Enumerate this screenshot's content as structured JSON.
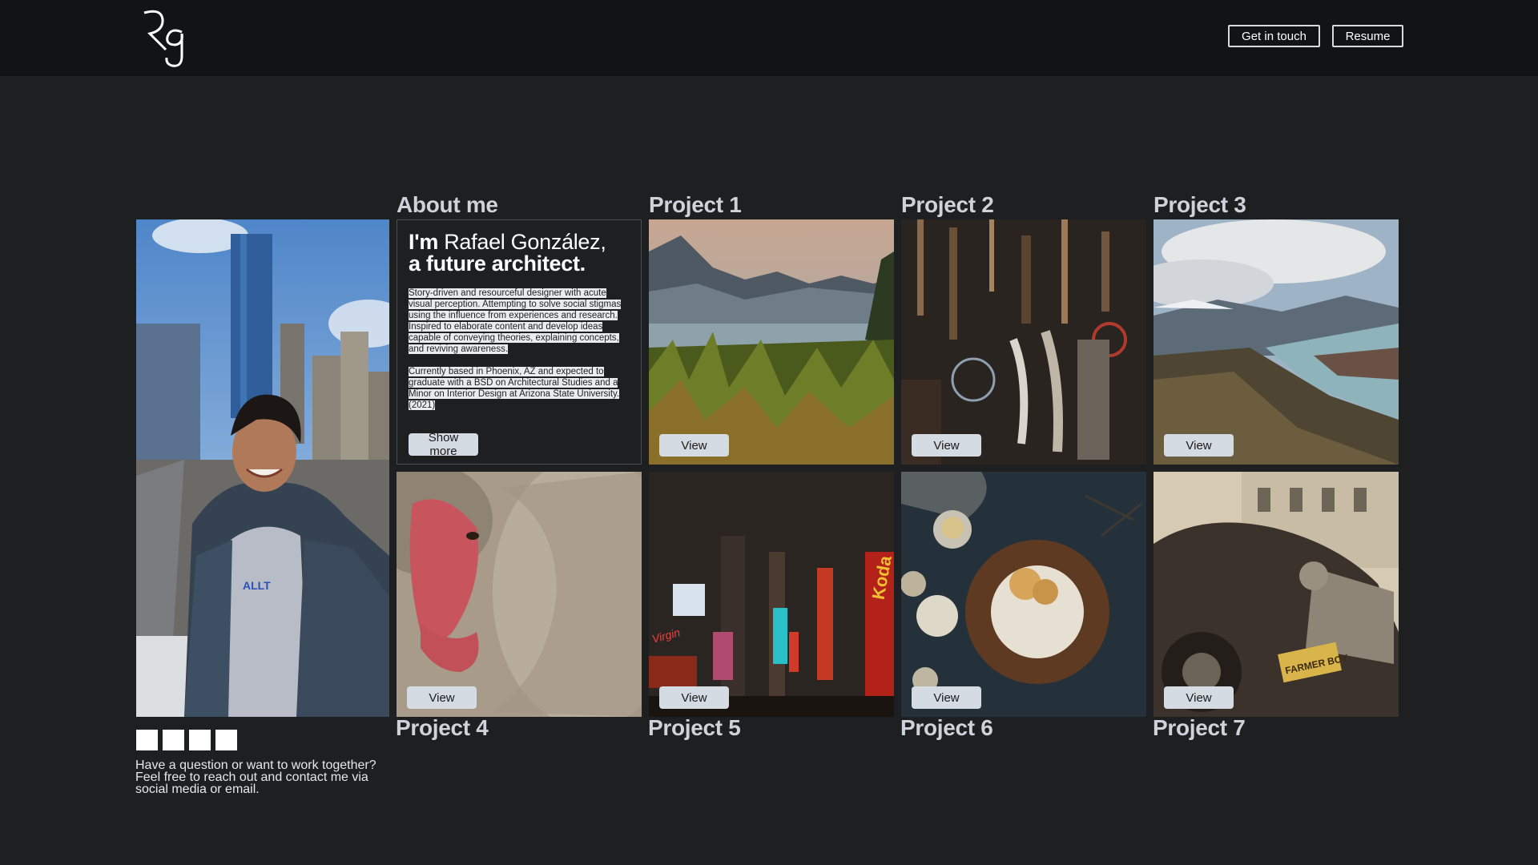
{
  "header": {
    "logo_label": "Rg",
    "get_in_touch_label": "Get in touch",
    "resume_label": "Resume"
  },
  "about": {
    "title": "About me",
    "heading_im": "I'm",
    "heading_name": " Rafael González,",
    "heading_line2": "a future architect.",
    "paragraph1": "Story-driven and resourceful designer with acute visual perception. Attempting to solve social stigmas using the influence from experiences and research. Inspired to elaborate content and develop ideas capable of conveying theories, explaining concepts, and reviving awareness.",
    "paragraph2": "Currently based in Phoenix, AZ and expected to graduate with a BSD on Architectural Studies and a Minor on Interior Design at Arizona State University. (2021)",
    "show_more_label": "Show more"
  },
  "projects": [
    {
      "title": "Project 1",
      "view_label": "View",
      "image": "lake-landscape"
    },
    {
      "title": "Project 2",
      "view_label": "View",
      "image": "tools-workshop"
    },
    {
      "title": "Project 3",
      "view_label": "View",
      "image": "mountain-fjord"
    },
    {
      "title": "Project 4",
      "view_label": "View",
      "image": "snow-monkey"
    },
    {
      "title": "Project 5",
      "view_label": "View",
      "image": "city-night"
    },
    {
      "title": "Project 6",
      "view_label": "View",
      "image": "dessert-table"
    },
    {
      "title": "Project 7",
      "view_label": "View",
      "image": "vintage-car"
    }
  ],
  "portrait": {
    "image": "portrait-city",
    "hoodie_text": "ALLT"
  },
  "project7_plate": "FARMER BOY",
  "project5_sign": "Koda",
  "project5_sign2": "Virgin",
  "socials": [
    "social-icon-1",
    "social-icon-2",
    "social-icon-3",
    "social-icon-4"
  ],
  "contact": {
    "text": "Have a question or want to work together? Feel free to reach out and contact me via social media or email."
  }
}
